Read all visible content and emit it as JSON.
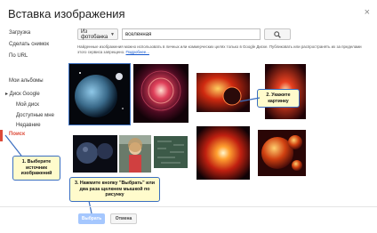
{
  "dialog": {
    "title": "Вставка изображения",
    "close_label": "×"
  },
  "sidebar": {
    "items": [
      {
        "label": "Загрузка"
      },
      {
        "label": "Сделать снимок"
      },
      {
        "label": "По URL"
      },
      {
        "label": "Мои альбомы"
      },
      {
        "label": "▸ Диск Google"
      },
      {
        "label": "Мой диск"
      },
      {
        "label": "Доступные мне"
      },
      {
        "label": "Недавние"
      },
      {
        "label": "Поиск"
      }
    ]
  },
  "search": {
    "source": "Из фотобанка",
    "query": "вселенная",
    "notice": "Найденные изображения можно использовать в личных или коммерческих целях только в Google Диске. Публиковать или распространять их за пределами этого сервиса запрещено.",
    "notice_link": "Подробнее..."
  },
  "callouts": {
    "pick_source": "1. Выберите источник изображений",
    "pick_image": "2. Укажите картинку",
    "press_select": "3. Нажмите кнопку \"Выбрать\" или два раза щелкнем мышкой по рисунку"
  },
  "footer": {
    "select_label": "Выбрать",
    "cancel_label": "Отмена"
  },
  "colors": {
    "accent": "#dd4b39",
    "primary_button": "#4d90fe",
    "callout_border": "#3a6ec0",
    "callout_fill": "#fffbcc"
  }
}
